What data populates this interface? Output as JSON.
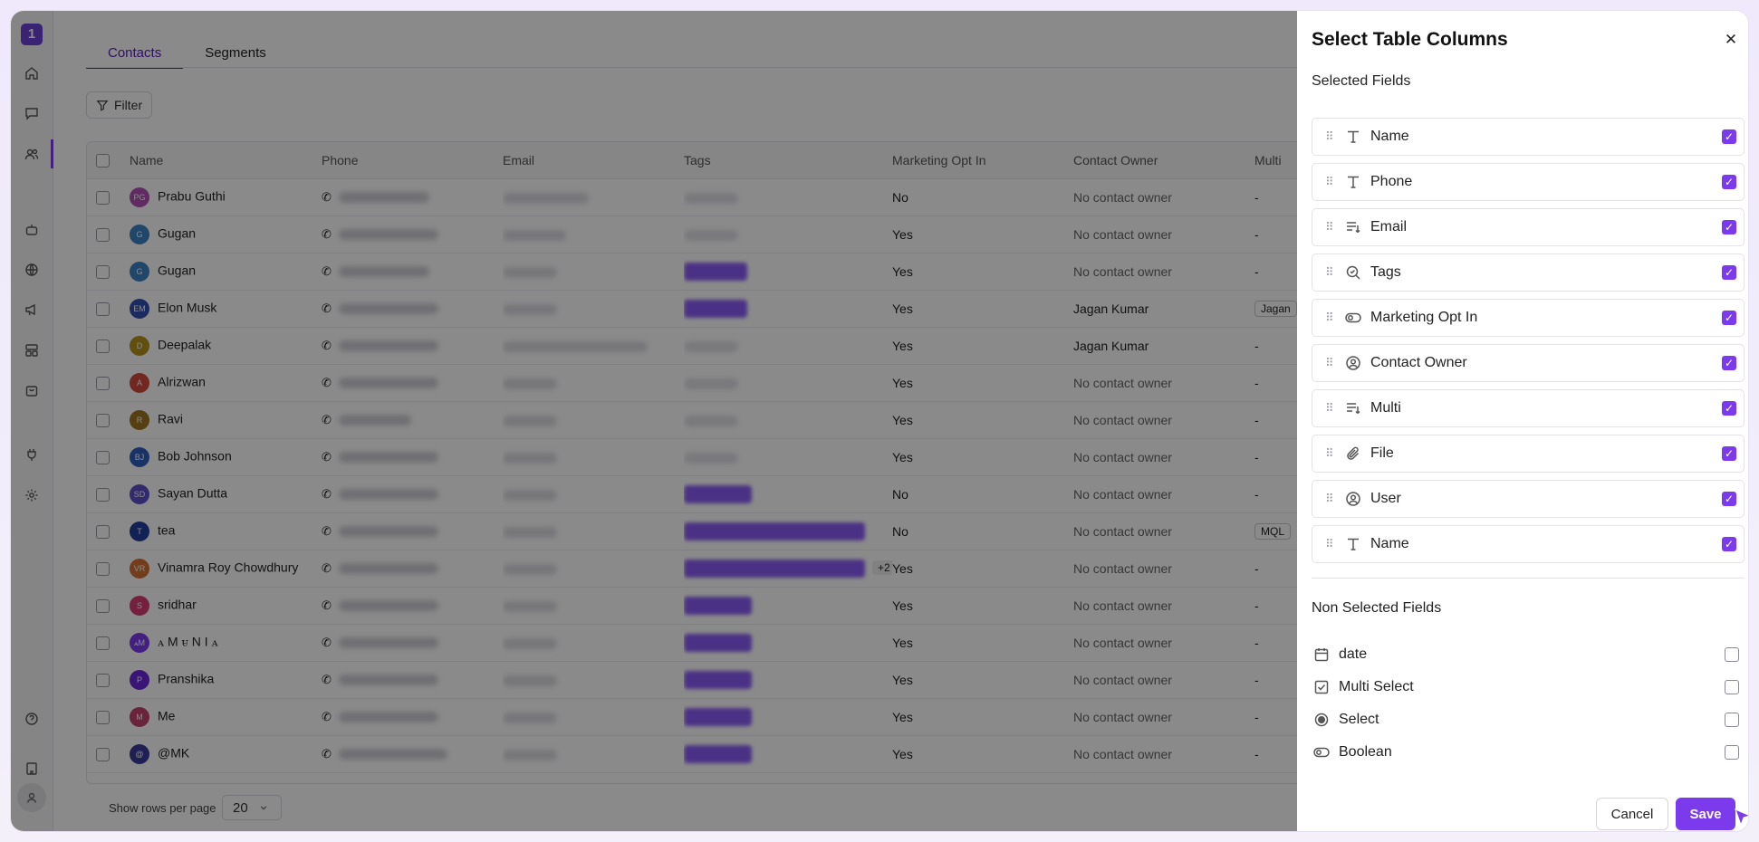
{
  "tabs": [
    {
      "label": "Contacts",
      "active": true
    },
    {
      "label": "Segments",
      "active": false
    }
  ],
  "filter_label": "Filter",
  "table": {
    "columns": [
      "Name",
      "Phone",
      "Email",
      "Tags",
      "Marketing Opt In",
      "Contact Owner",
      "Multi"
    ],
    "rows": [
      {
        "initials": "PG",
        "color": "#b24fb8",
        "name": "Prabu Guthi",
        "opt": "No",
        "owner": "No contact owner",
        "multi": "-"
      },
      {
        "initials": "G",
        "color": "#3b82c4",
        "name": "Gugan",
        "opt": "Yes",
        "owner": "No contact owner",
        "multi": "-"
      },
      {
        "initials": "G",
        "color": "#3b82c4",
        "name": "Gugan",
        "opt": "Yes",
        "owner": "No contact owner",
        "multi": "-"
      },
      {
        "initials": "EM",
        "color": "#334fb0",
        "name": "Elon Musk",
        "opt": "Yes",
        "owner": "Jagan Kumar",
        "multi": "Jagan"
      },
      {
        "initials": "D",
        "color": "#b4931f",
        "name": "Deepalak",
        "opt": "Yes",
        "owner": "Jagan Kumar",
        "multi": "-"
      },
      {
        "initials": "A",
        "color": "#d14b3e",
        "name": "Alrizwan",
        "opt": "Yes",
        "owner": "No contact owner",
        "multi": "-"
      },
      {
        "initials": "R",
        "color": "#a0751e",
        "name": "Ravi",
        "opt": "Yes",
        "owner": "No contact owner",
        "multi": "-"
      },
      {
        "initials": "BJ",
        "color": "#2f5fbf",
        "name": "Bob Johnson",
        "opt": "Yes",
        "owner": "No contact owner",
        "multi": "-"
      },
      {
        "initials": "SD",
        "color": "#5b51c9",
        "name": "Sayan Dutta",
        "opt": "No",
        "owner": "No contact owner",
        "multi": "-"
      },
      {
        "initials": "T",
        "color": "#23409b",
        "name": "tea",
        "opt": "No",
        "owner": "No contact owner",
        "multi": "MQL"
      },
      {
        "initials": "VR",
        "color": "#d47032",
        "name": "Vinamra Roy Chowdhury",
        "opt": "Yes",
        "owner": "No contact owner",
        "multi": "-",
        "tagExtra": "+2"
      },
      {
        "initials": "S",
        "color": "#d63b73",
        "name": "sridhar",
        "opt": "Yes",
        "owner": "No contact owner",
        "multi": "-"
      },
      {
        "initials": "ꭺM",
        "color": "#7c3aed",
        "name": "ꭺ M ꮜ N I ꭺ",
        "opt": "Yes",
        "owner": "No contact owner",
        "multi": "-"
      },
      {
        "initials": "P",
        "color": "#6d28d9",
        "name": "Pranshika",
        "opt": "Yes",
        "owner": "No contact owner",
        "multi": "-"
      },
      {
        "initials": "M",
        "color": "#c2416c",
        "name": "Me",
        "opt": "Yes",
        "owner": "No contact owner",
        "multi": "-"
      },
      {
        "initials": "@",
        "color": "#3a3a9b",
        "name": "@MK",
        "opt": "Yes",
        "owner": "No contact owner",
        "multi": "-"
      }
    ]
  },
  "footer": {
    "rows_label": "Show rows per page",
    "rows_value": "20"
  },
  "panel": {
    "title": "Select Table Columns",
    "selected_heading": "Selected Fields",
    "selected": [
      {
        "label": "Name",
        "icon": "text-icon"
      },
      {
        "label": "Phone",
        "icon": "text-icon"
      },
      {
        "label": "Email",
        "icon": "list-icon"
      },
      {
        "label": "Tags",
        "icon": "tag-search-icon"
      },
      {
        "label": "Marketing Opt In",
        "icon": "toggle-icon"
      },
      {
        "label": "Contact Owner",
        "icon": "user-circle-icon"
      },
      {
        "label": "Multi",
        "icon": "list-icon"
      },
      {
        "label": "File",
        "icon": "paperclip-icon"
      },
      {
        "label": "User",
        "icon": "user-circle-icon"
      },
      {
        "label": "Name",
        "icon": "text-icon"
      }
    ],
    "non_selected_heading": "Non Selected Fields",
    "non_selected": [
      {
        "label": "date",
        "icon": "calendar-icon"
      },
      {
        "label": "Multi Select",
        "icon": "checkbox-icon"
      },
      {
        "label": "Select",
        "icon": "radio-icon"
      },
      {
        "label": "Boolean",
        "icon": "toggle-icon"
      }
    ],
    "cancel_label": "Cancel",
    "save_label": "Save"
  }
}
